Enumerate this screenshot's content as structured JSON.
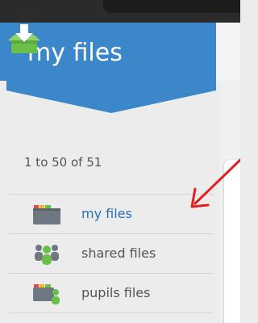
{
  "banner": {
    "title": "my files",
    "icon": "download-folder-icon",
    "color": "#3c87c9"
  },
  "file_count": "1 to 50 of 51",
  "nav": {
    "items": [
      {
        "label": "my files",
        "icon": "folder-icon",
        "active": true
      },
      {
        "label": "shared files",
        "icon": "people-icon",
        "active": false
      },
      {
        "label": "pupils files",
        "icon": "pupil-folder-icon",
        "active": false
      }
    ]
  },
  "annotation": {
    "icon": "red-arrow-icon",
    "color": "#e02020"
  },
  "colors": {
    "link_active": "#2a6fae",
    "text": "#555555",
    "icon_green": "#6abf4b"
  }
}
